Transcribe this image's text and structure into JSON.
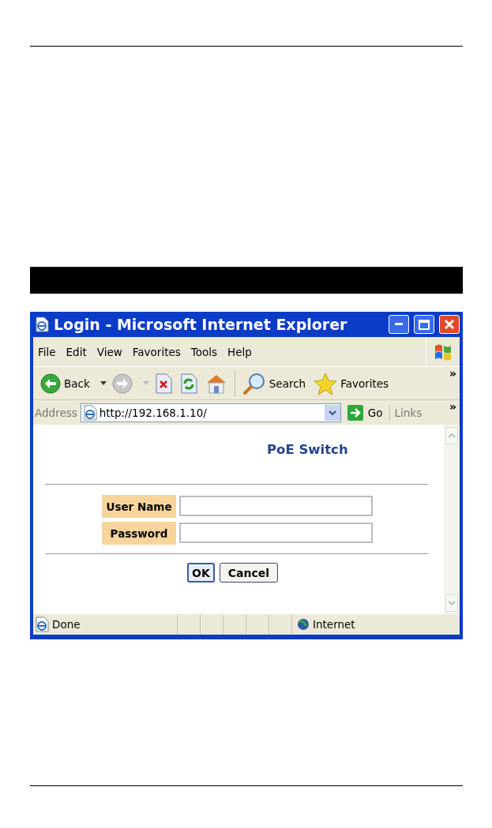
{
  "window": {
    "title": "Login - Microsoft Internet Explorer"
  },
  "menu": [
    {
      "label": "File"
    },
    {
      "label": "Edit"
    },
    {
      "label": "View"
    },
    {
      "label": "Favorites"
    },
    {
      "label": "Tools"
    },
    {
      "label": "Help"
    }
  ],
  "toolbar": [
    {
      "kind": "back",
      "label": "Back"
    },
    {
      "kind": "forward"
    },
    {
      "kind": "stop"
    },
    {
      "kind": "refresh"
    },
    {
      "kind": "home"
    },
    {
      "kind": "search",
      "label": "Search"
    },
    {
      "kind": "favorites",
      "label": "Favorites"
    }
  ],
  "toolbar_more": "»",
  "address_bar": {
    "label": "Address",
    "url": "http://192.168.1.10/",
    "go": "Go",
    "links": "Links",
    "more": "»"
  },
  "page": {
    "heading": "PoE Switch",
    "fields": [
      {
        "label": "User Name"
      },
      {
        "label": "Password"
      }
    ],
    "buttons": [
      {
        "label": "OK",
        "default": true
      },
      {
        "label": "Cancel",
        "default": false
      }
    ]
  },
  "status_bar": {
    "text": "Done",
    "zone": "Internet"
  }
}
